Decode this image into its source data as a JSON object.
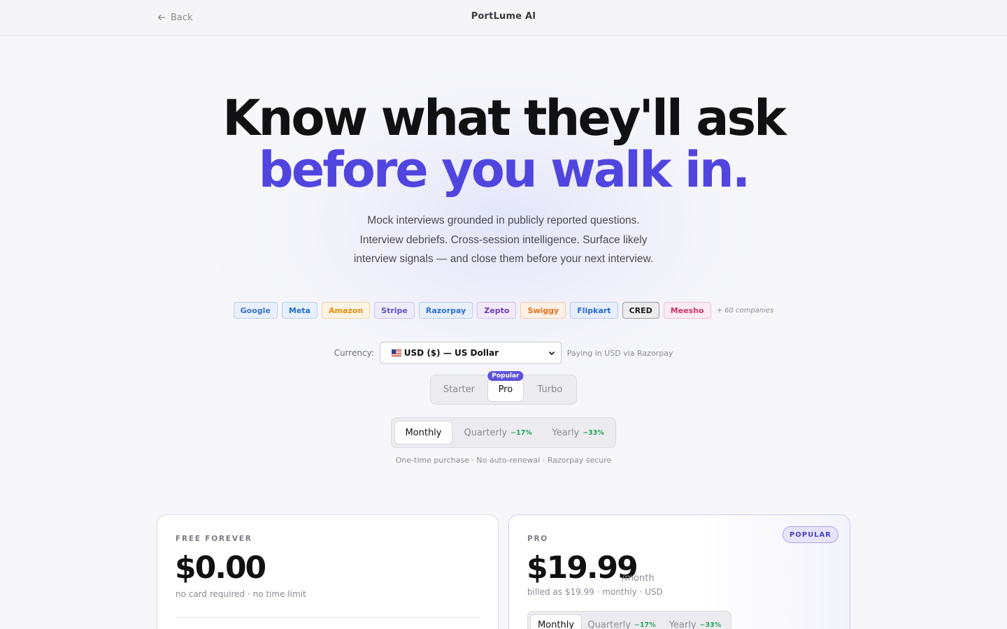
{
  "header": {
    "back_label": "Back",
    "brand": "PortLume AI"
  },
  "hero": {
    "line1": "Know what they'll ask",
    "line2": "before you walk in.",
    "subtitle": "Mock interviews grounded in publicly reported questions. Interview debriefs. Cross-session intelligence. Surface likely interview signals — and close them before your next interview."
  },
  "companies": {
    "items": [
      {
        "name": "Google",
        "color": "#3b73c9",
        "bg": "#e9f0fb",
        "border": "#b9cdee"
      },
      {
        "name": "Meta",
        "color": "#1f6fd1",
        "bg": "#e6f0fc",
        "border": "#b3cff1"
      },
      {
        "name": "Amazon",
        "color": "#e08c12",
        "bg": "#fdf3e4",
        "border": "#f2d3a6"
      },
      {
        "name": "Stripe",
        "color": "#5e54c9",
        "bg": "#eeecfb",
        "border": "#cbc6f0"
      },
      {
        "name": "Razorpay",
        "color": "#2f6fd6",
        "bg": "#e8f0fc",
        "border": "#b8cdf0"
      },
      {
        "name": "Zepto",
        "color": "#6a3bb8",
        "bg": "#f1eafb",
        "border": "#d2c0ee"
      },
      {
        "name": "Swiggy",
        "color": "#e5731c",
        "bg": "#fdf0e5",
        "border": "#f3cda9"
      },
      {
        "name": "Flipkart",
        "color": "#2b67cf",
        "bg": "#e7effc",
        "border": "#b6cbef"
      },
      {
        "name": "CRED",
        "color": "#1a1a1a",
        "bg": "#ececef",
        "border": "#9a9aa2"
      },
      {
        "name": "Meesho",
        "color": "#c8336b",
        "bg": "#fcebf2",
        "border": "#efbdd0"
      }
    ],
    "more": "+ 60 companies"
  },
  "currency": {
    "label": "Currency:",
    "selected": "USD ($) — US Dollar",
    "note": "Paying in USD via Razorpay"
  },
  "plans": {
    "tabs": [
      {
        "label": "Starter",
        "active": false
      },
      {
        "label": "Pro",
        "active": true,
        "tag": "Popular"
      },
      {
        "label": "Turbo",
        "active": false
      }
    ]
  },
  "billing": {
    "tabs": [
      {
        "label": "Monthly",
        "discount": "",
        "active": true
      },
      {
        "label": "Quarterly",
        "discount": "−17%",
        "active": false
      },
      {
        "label": "Yearly",
        "discount": "−33%",
        "active": false
      }
    ],
    "note": "One-time purchase · No auto-renewal · Razorpay secure"
  },
  "cards": {
    "free": {
      "kicker": "FREE FOREVER",
      "price": "$0.00",
      "sub": "no card required · no time limit"
    },
    "pro": {
      "kicker": "PRO",
      "badge": "POPULAR",
      "price": "$19.99",
      "per": "/month",
      "sub": "billed as $19.99 · monthly · USD",
      "tabs": [
        {
          "label": "Monthly",
          "discount": ""
        },
        {
          "label": "Quarterly",
          "discount": "−17%"
        },
        {
          "label": "Yearly",
          "discount": "−33%"
        }
      ]
    }
  },
  "colors": {
    "accent": "#5145e0",
    "success": "#22a55a"
  }
}
